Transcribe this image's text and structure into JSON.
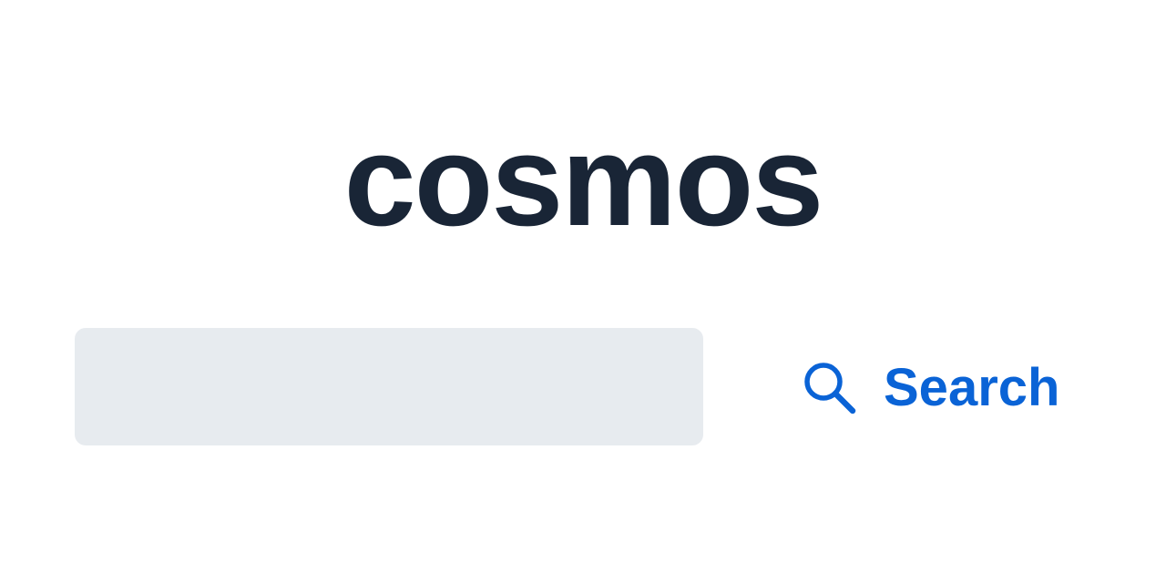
{
  "brand": {
    "logo_text": "cosmos"
  },
  "search": {
    "input_value": "",
    "placeholder": "",
    "button_label": "Search",
    "button_icon": "search-icon"
  },
  "colors": {
    "logo": "#192536",
    "input_background": "#e7ebef",
    "accent": "#0a63d6",
    "page_background": "#ffffff"
  }
}
